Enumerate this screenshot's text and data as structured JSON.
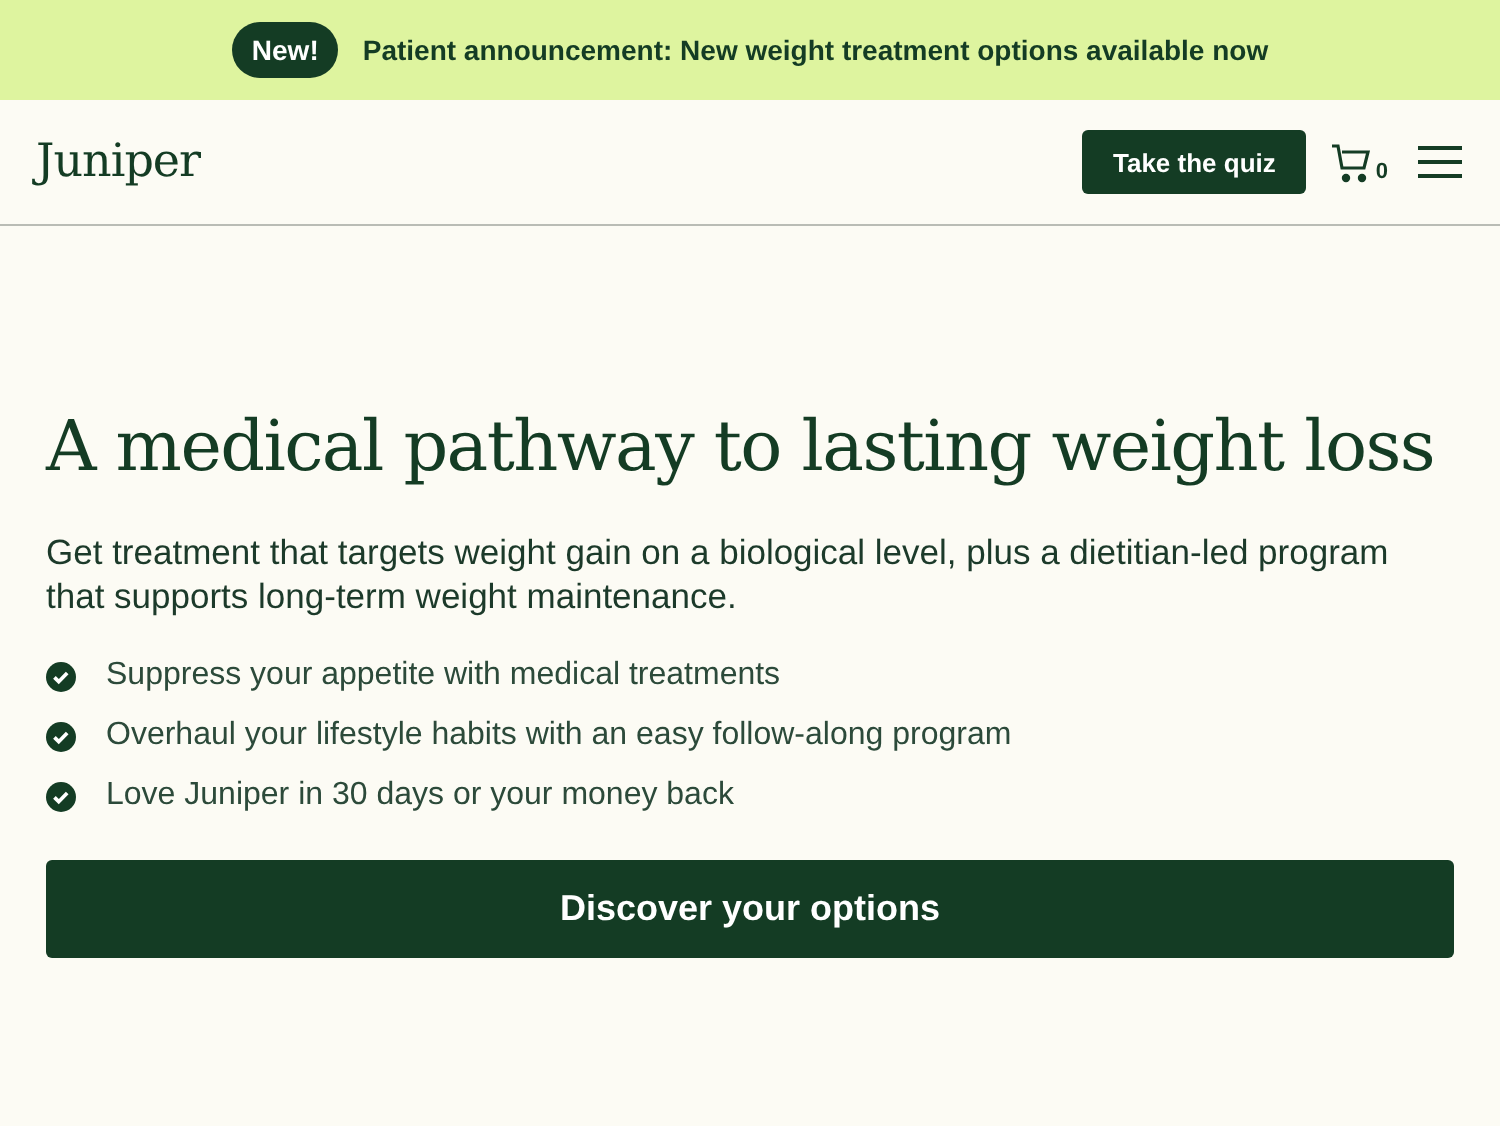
{
  "announcement": {
    "badge": "New!",
    "text": "Patient announcement: New weight treatment options available now"
  },
  "header": {
    "logo": "Juniper",
    "quiz_button": "Take the quiz",
    "cart_count": "0"
  },
  "hero": {
    "title": "A medical pathway to lasting weight loss",
    "subtitle": "Get treatment that targets weight gain on a biological level, plus a dietitian-led program that supports long-term weight maintenance.",
    "benefits": [
      "Suppress your appetite with medical treatments",
      "Overhaul your lifestyle habits with an easy follow-along program",
      "Love Juniper in 30 days or your money back"
    ],
    "cta": "Discover your options"
  }
}
